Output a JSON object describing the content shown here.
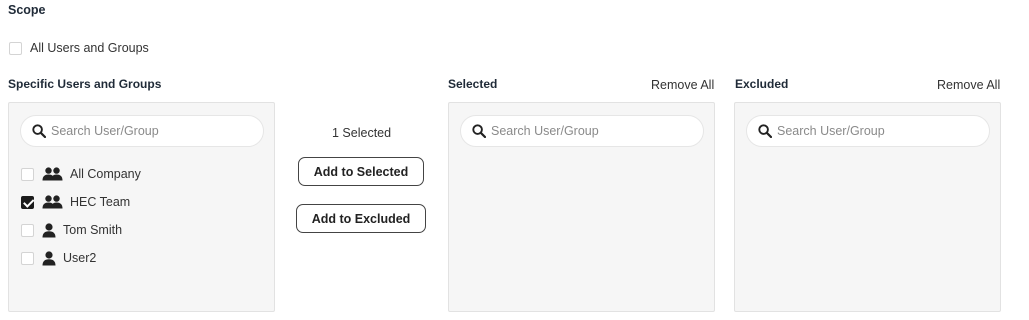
{
  "scope": {
    "title": "Scope",
    "all_users_label": "All Users and Groups",
    "all_users_checked": false
  },
  "specific": {
    "heading": "Specific Users and Groups",
    "search_placeholder": "Search User/Group",
    "items": [
      {
        "label": "All Company",
        "icon": "group-icon",
        "checked": false
      },
      {
        "label": "HEC Team",
        "icon": "group-icon",
        "checked": true
      },
      {
        "label": "Tom Smith",
        "icon": "user-icon",
        "checked": false
      },
      {
        "label": "User2",
        "icon": "user-icon",
        "checked": false
      }
    ]
  },
  "actions": {
    "selected_count": "1 Selected",
    "add_selected_label": "Add to Selected",
    "add_excluded_label": "Add to Excluded"
  },
  "selected": {
    "heading": "Selected",
    "remove_all_label": "Remove All",
    "search_placeholder": "Search User/Group"
  },
  "excluded": {
    "heading": "Excluded",
    "remove_all_label": "Remove All",
    "search_placeholder": "Search User/Group"
  },
  "colors": {
    "panel_bg": "#f6f6f6",
    "checkbox_checked": "#1b1b1b",
    "heading_text": "#1f2a37"
  }
}
